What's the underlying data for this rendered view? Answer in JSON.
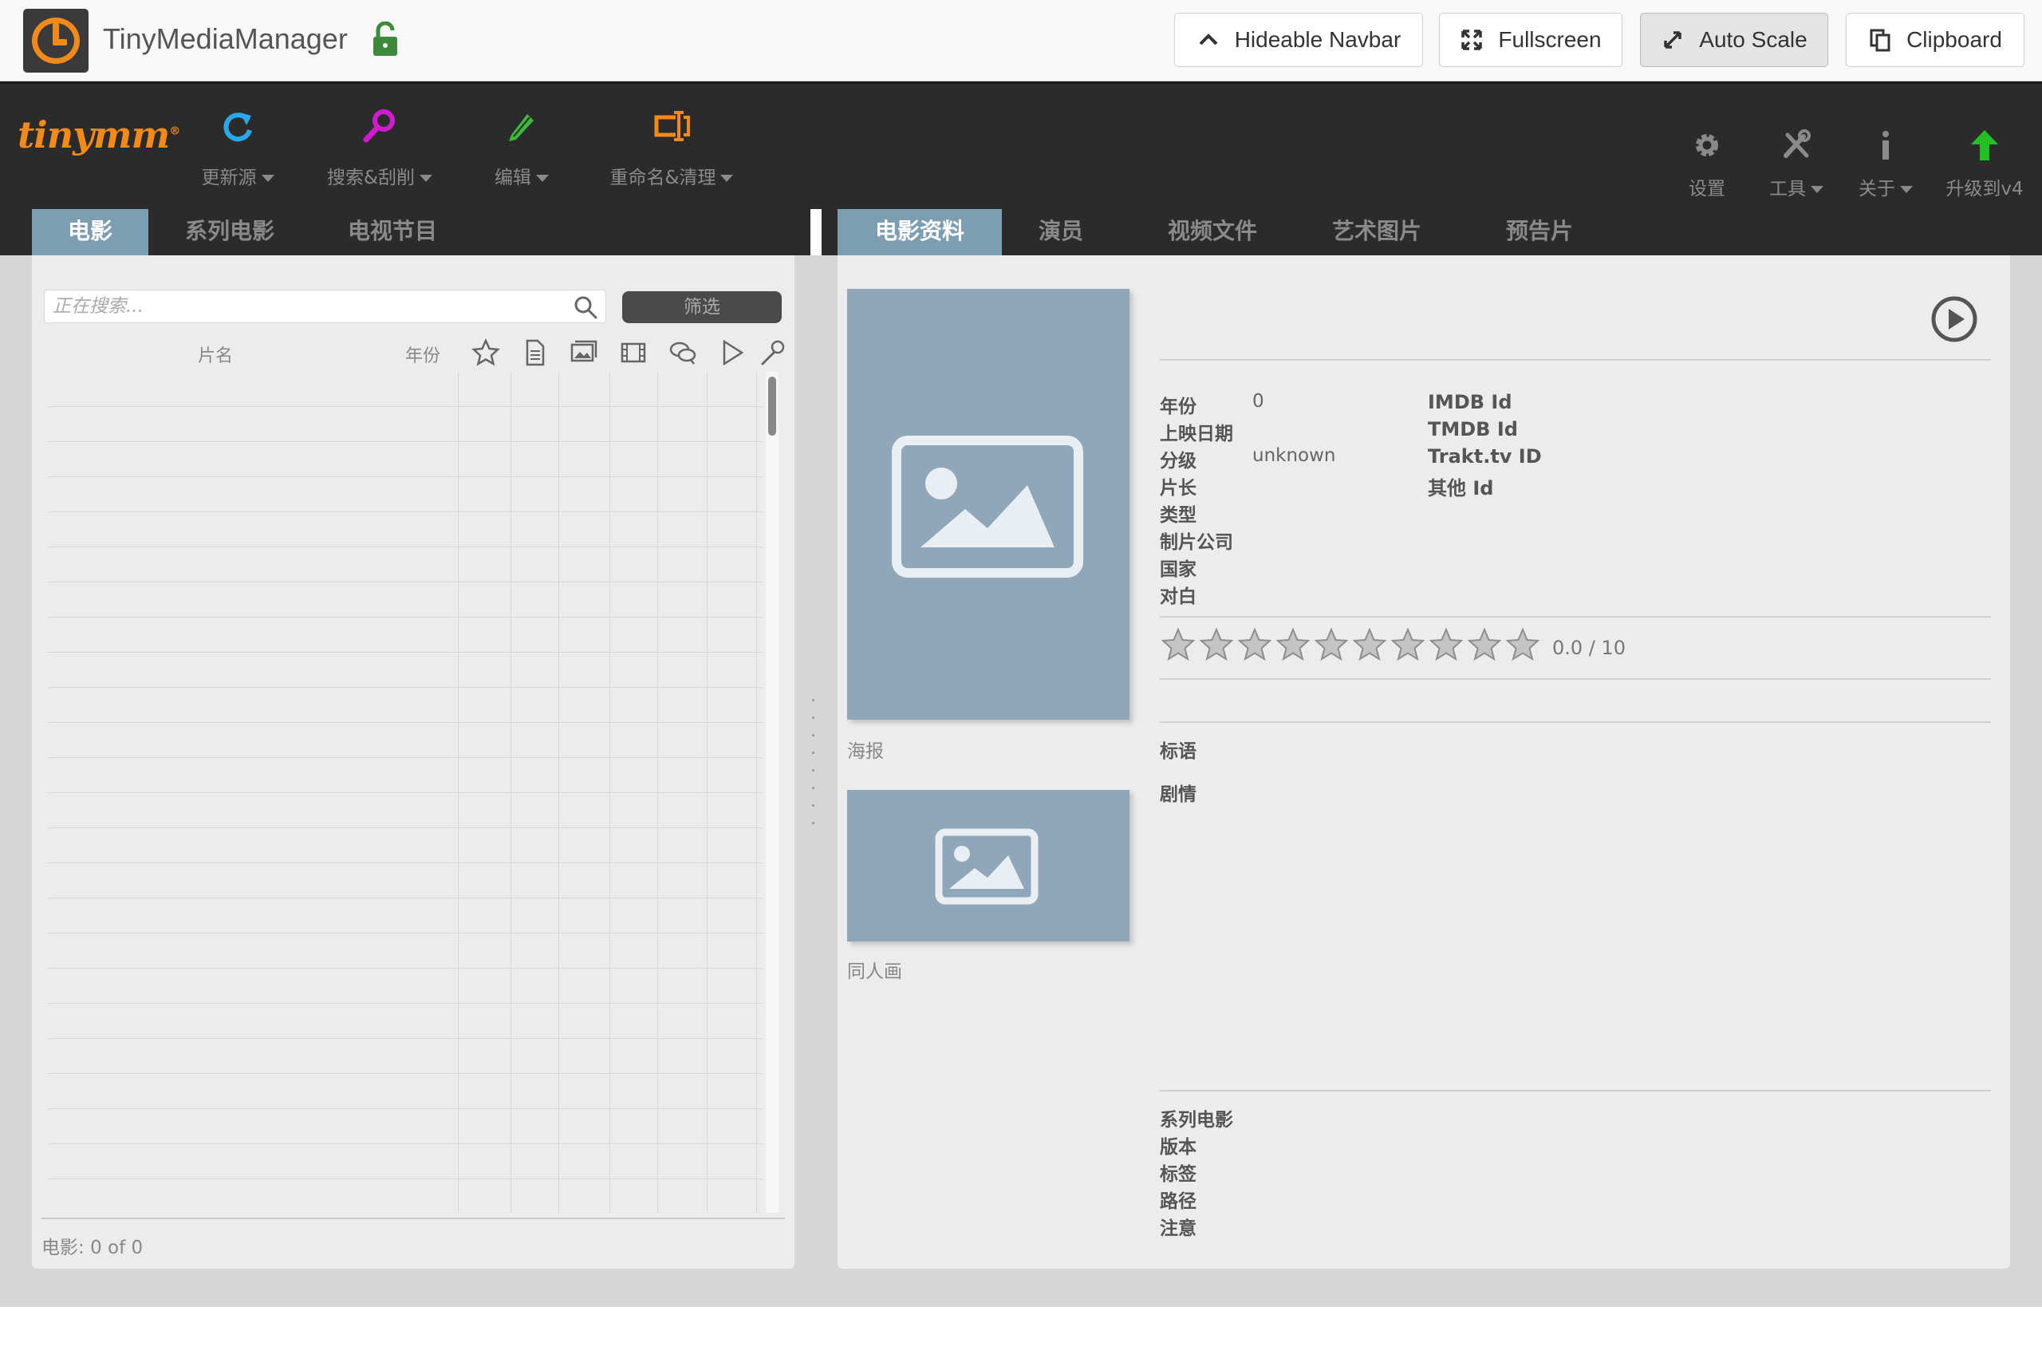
{
  "topbar": {
    "app_title": "TinyMediaManager",
    "buttons": [
      {
        "label": "Hideable Navbar"
      },
      {
        "label": "Fullscreen"
      },
      {
        "label": "Auto Scale",
        "active": true
      },
      {
        "label": "Clipboard"
      }
    ]
  },
  "toolbar": {
    "logo": "tinymm",
    "logo_mark": "®",
    "left_tools": [
      {
        "label": "更新源",
        "icon": "refresh-icon",
        "color": "#2aa8e8"
      },
      {
        "label": "搜索&刮削",
        "icon": "search-icon",
        "color": "#d01cd0"
      },
      {
        "label": "编辑",
        "icon": "edit-icon",
        "color": "#3cb83c"
      },
      {
        "label": "重命名&清理",
        "icon": "rename-icon",
        "color": "#f28a1b"
      }
    ],
    "right_tools": [
      {
        "label": "设置",
        "icon": "gear-icon"
      },
      {
        "label": "工具",
        "icon": "tools-icon"
      },
      {
        "label": "关于",
        "icon": "info-icon"
      },
      {
        "label": "升级到v4",
        "icon": "upgrade-arrow-icon",
        "color": "#22c022"
      }
    ]
  },
  "left_tabs": [
    {
      "label": "电影",
      "active": true
    },
    {
      "label": "系列电影"
    },
    {
      "label": "电视节目"
    }
  ],
  "right_tabs": [
    {
      "label": "电影资料",
      "active": true
    },
    {
      "label": "演员"
    },
    {
      "label": "视频文件"
    },
    {
      "label": "艺术图片"
    },
    {
      "label": "预告片"
    }
  ],
  "movie_list": {
    "search_placeholder": "正在搜索...",
    "filter_label": "筛选",
    "columns": {
      "title": "片名",
      "year": "年份"
    },
    "column_icons": [
      "star-icon",
      "document-icon",
      "images-icon",
      "film-icon",
      "chat-icon",
      "play-icon",
      "wrench-icon"
    ],
    "count_label": "电影:",
    "count": "0",
    "of_label": "of",
    "total": "0"
  },
  "details": {
    "poster_caption": "海报",
    "fanart_caption": "同人画",
    "fields": [
      {
        "label": "年份",
        "value": "0"
      },
      {
        "label": "上映日期",
        "value": ""
      },
      {
        "label": "分级",
        "value": "unknown"
      },
      {
        "label": "片长",
        "value": ""
      },
      {
        "label": "类型",
        "value": ""
      },
      {
        "label": "制片公司",
        "value": ""
      },
      {
        "label": "国家",
        "value": ""
      },
      {
        "label": "对白",
        "value": ""
      }
    ],
    "ids": [
      "IMDB Id",
      "TMDB Id",
      "Trakt.tv ID",
      "其他 Id"
    ],
    "rating": {
      "value": 0.0,
      "max": 10,
      "text": "0.0 / 10",
      "stars": 10
    },
    "tagline_label": "标语",
    "plot_label": "剧情",
    "bottom_fields": [
      "系列电影",
      "版本",
      "标签",
      "路径",
      "注意"
    ]
  },
  "colors": {
    "accent_tab": "#7d9db1",
    "toolbar_bg": "#2b2b2b",
    "brand_orange": "#f28a1b",
    "image_placeholder": "#8fa7b8",
    "lock_green": "#3d8a3d"
  }
}
